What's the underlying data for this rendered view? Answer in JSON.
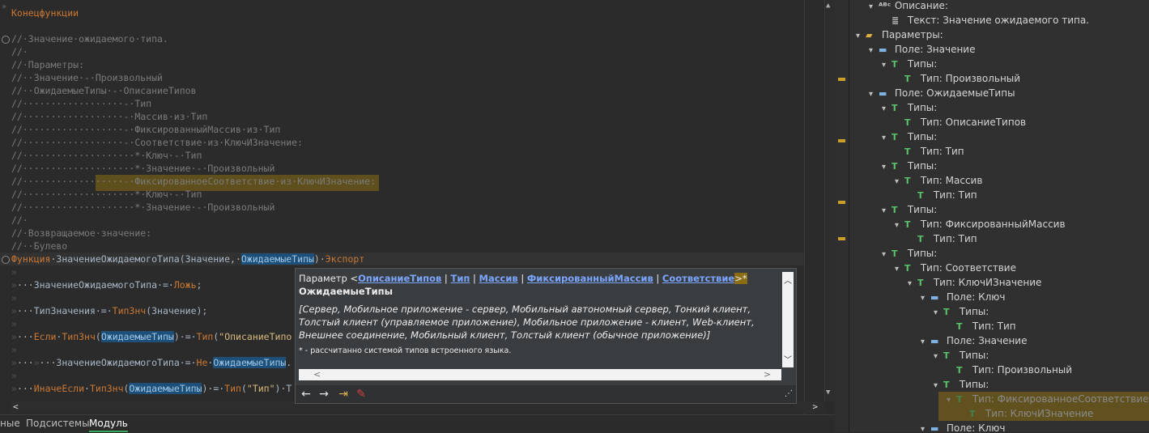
{
  "editor": {
    "lines": [
      {
        "gutter": "»",
        "html": "<span class=\"kw\">Конецфункции</span>"
      },
      {
        "gutter": "",
        "html": ""
      },
      {
        "gutter": "",
        "html": "<span class=\"cmt\">//·Значение·ожидаемого·типа.</span>"
      },
      {
        "gutter": "",
        "html": "<span class=\"cmt\">//·</span>"
      },
      {
        "gutter": "",
        "html": "<span class=\"cmt\">//·Параметры:</span>"
      },
      {
        "gutter": "",
        "html": "<span class=\"cmt\">//··Значение·-·Произвольный</span>"
      },
      {
        "gutter": "",
        "html": "<span class=\"cmt\">//··ОжидаемыеТипы·-·ОписаниеТипов</span>"
      },
      {
        "gutter": "",
        "html": "<span class=\"cmt\">//··················-·Тип</span>"
      },
      {
        "gutter": "",
        "html": "<span class=\"cmt\">//··················-·Массив·из·Тип</span>"
      },
      {
        "gutter": "",
        "html": "<span class=\"cmt\">//··················-·ФиксированныйМассив·из·Тип</span>"
      },
      {
        "gutter": "",
        "html": "<span class=\"cmt\">//··················-·Соответствие·из·КлючИЗначение:</span>"
      },
      {
        "gutter": "",
        "html": "<span class=\"cmt\">//····················*·Ключ·-·Тип</span>"
      },
      {
        "gutter": "",
        "html": "<span class=\"cmt\">//····················*·Значение·-·Произвольный</span>"
      },
      {
        "gutter": "",
        "html": "<span class=\"cmt\">//··················-·ФиксированноеСоответствие·из·КлючИЗначение:</span>"
      },
      {
        "gutter": "",
        "html": "<span class=\"cmt\">//····················*·Ключ·-·Тип</span>"
      },
      {
        "gutter": "",
        "html": "<span class=\"cmt\">//····················*·Значение·-·Произвольный</span>"
      },
      {
        "gutter": "",
        "html": "<span class=\"cmt\">//·</span>"
      },
      {
        "gutter": "",
        "html": "<span class=\"cmt\">//·Возвращаемое·значение:</span>"
      },
      {
        "gutter": "",
        "html": "<span class=\"cmt\">//··Булево</span>"
      },
      {
        "gutter": "",
        "html": "<span class=\"kw\">Функция</span>·ЗначениеОжидаемогоТипа(Значение,·<span class=\"hl\">ОжидаемыеТипы</span>)·<span class=\"kw\">Экспорт</span>"
      },
      {
        "gutter": "",
        "html": "<span class=\"ws\">»</span>"
      },
      {
        "gutter": "",
        "html": "<span class=\"ws\">»</span>···ЗначениеОжидаемогоТипа·=·<span class=\"kw\">Ложь</span>;"
      },
      {
        "gutter": "",
        "html": "<span class=\"ws\">»</span>"
      },
      {
        "gutter": "",
        "html": "<span class=\"ws\">»</span>···ТипЗначения·=·<span class=\"kw\">ТипЗнч</span>(Значение);"
      },
      {
        "gutter": "",
        "html": "<span class=\"ws\">»</span>"
      },
      {
        "gutter": "",
        "html": "<span class=\"ws\">»</span>···<span class=\"kw\">Если</span>·<span class=\"kw\">ТипЗнч</span>(<span class=\"hl\">ОжидаемыеТипы</span>)·=·<span class=\"kw\">Тип</span>(<span class=\"str\">\"ОписаниеТипо</span>"
      },
      {
        "gutter": "",
        "html": "<span class=\"ws\">»</span>"
      },
      {
        "gutter": "",
        "html": "<span class=\"ws\">»</span>···<span class=\"ws\">»</span>···ЗначениеОжидаемогоТипа·=·<span class=\"kw\">Не</span>·<span class=\"hl\">ОжидаемыеТипы</span>."
      },
      {
        "gutter": "",
        "html": "<span class=\"ws\">»</span>"
      },
      {
        "gutter": "",
        "html": "<span class=\"ws\">»</span>···<span class=\"kw\">ИначеЕсли</span>·<span class=\"kw\">ТипЗнч</span>(<span class=\"hl\">ОжидаемыеТипы</span>)·=·<span class=\"kw\">Тип</span>(<span class=\"str\">\"Тип\"</span>)·Т"
      }
    ]
  },
  "bottom_tabs": {
    "t1": "ные",
    "t2": "Подсистемы",
    "t3": "Модуль"
  },
  "popup": {
    "prefix": "Параметр <",
    "types": [
      "ОписаниеТипов",
      "Тип",
      "Массив",
      "ФиксированныйМассив",
      "Соответствие"
    ],
    "sep": " | ",
    "suffix": ">*",
    "name": "ОжидаемыеТипы",
    "context": "[Сервер, Мобильное приложение - сервер, Мобильный автономный сервер, Тонкий клиент, Толстый клиент (управляемое приложение), Мобильное приложение - клиент, Web-клиент, Внешнее соединение, Мобильный клиент, Толстый клиент (обычное приложение)]",
    "footnote": "* - рассчитанно системой типов встроенного языка."
  },
  "outline": [
    {
      "d": 1,
      "tw": "▾",
      "icon": "abc",
      "label": "Описание:"
    },
    {
      "d": 2,
      "tw": "",
      "icon": "text",
      "label": "Текст: Значение ожидаемого типа."
    },
    {
      "d": 0,
      "tw": "▾",
      "icon": "folder",
      "label": "Параметры:"
    },
    {
      "d": 1,
      "tw": "▾",
      "icon": "field",
      "label": "Поле: Значение"
    },
    {
      "d": 2,
      "tw": "▾",
      "icon": "types",
      "label": "Типы:"
    },
    {
      "d": 3,
      "tw": "",
      "icon": "type",
      "label": "Тип: Произвольный"
    },
    {
      "d": 1,
      "tw": "▾",
      "icon": "field",
      "label": "Поле: ОжидаемыеТипы"
    },
    {
      "d": 2,
      "tw": "▾",
      "icon": "types",
      "label": "Типы:"
    },
    {
      "d": 3,
      "tw": "",
      "icon": "type",
      "label": "Тип: ОписаниеТипов"
    },
    {
      "d": 2,
      "tw": "▾",
      "icon": "types",
      "label": "Типы:"
    },
    {
      "d": 3,
      "tw": "",
      "icon": "type",
      "label": "Тип: Тип"
    },
    {
      "d": 2,
      "tw": "▾",
      "icon": "types",
      "label": "Типы:"
    },
    {
      "d": 3,
      "tw": "▾",
      "icon": "type",
      "label": "Тип: Массив"
    },
    {
      "d": 4,
      "tw": "",
      "icon": "type",
      "label": "Тип: Тип"
    },
    {
      "d": 2,
      "tw": "▾",
      "icon": "types",
      "label": "Типы:"
    },
    {
      "d": 3,
      "tw": "▾",
      "icon": "type",
      "label": "Тип: ФиксированныйМассив"
    },
    {
      "d": 4,
      "tw": "",
      "icon": "type",
      "label": "Тип: Тип"
    },
    {
      "d": 2,
      "tw": "▾",
      "icon": "types",
      "label": "Типы:"
    },
    {
      "d": 3,
      "tw": "▾",
      "icon": "type",
      "label": "Тип: Соответствие"
    },
    {
      "d": 4,
      "tw": "▾",
      "icon": "type",
      "label": "Тип: КлючИЗначение"
    },
    {
      "d": 5,
      "tw": "▾",
      "icon": "field",
      "label": "Поле: Ключ"
    },
    {
      "d": 6,
      "tw": "▾",
      "icon": "types",
      "label": "Типы:"
    },
    {
      "d": 7,
      "tw": "",
      "icon": "type",
      "label": "Тип: Тип"
    },
    {
      "d": 5,
      "tw": "▾",
      "icon": "field",
      "label": "Поле: Значение"
    },
    {
      "d": 6,
      "tw": "▾",
      "icon": "types",
      "label": "Типы:"
    },
    {
      "d": 7,
      "tw": "",
      "icon": "type",
      "label": "Тип: Произвольный"
    },
    {
      "d": 6,
      "tw": "▾",
      "icon": "types",
      "label": "Типы:"
    },
    {
      "d": 7,
      "tw": "▾",
      "icon": "type",
      "label": "Тип: ФиксированноеСоответствие",
      "sel": true
    },
    {
      "d": 8,
      "tw": "",
      "icon": "type",
      "label": "Тип: КлючИЗначение",
      "sel": true
    },
    {
      "d": 5,
      "tw": "▾",
      "icon": "field",
      "label": "Поле: Ключ"
    }
  ],
  "colors": {
    "highlight": "#8a6d12",
    "keyword": "#cc7832",
    "link": "#7aa6ff"
  }
}
